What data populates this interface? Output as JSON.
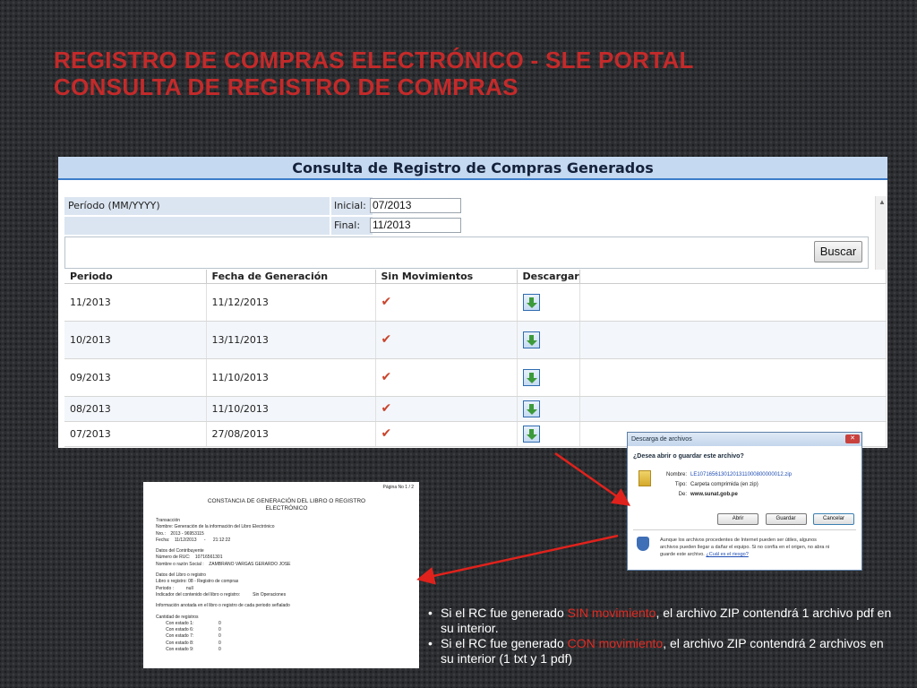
{
  "slide": {
    "title_line1": "REGISTRO DE COMPRAS ELECTRÓNICO - SLE PORTAL",
    "title_line2": "CONSULTA DE REGISTRO DE COMPRAS"
  },
  "panel": {
    "heading": "Consulta de Registro de Compras Generados",
    "period_label": "Período (MM/YYYY)",
    "initial_label": "Inicial:",
    "initial_value": "07/2013",
    "final_label": "Final:",
    "final_value": "11/2013",
    "search_button": "Buscar",
    "columns": [
      "Periodo",
      "Fecha de Generación",
      "Sin Movimientos",
      "Descargar"
    ],
    "rows": [
      {
        "periodo": "11/2013",
        "fecha": "11/12/2013",
        "sin_mov": "✔"
      },
      {
        "periodo": "10/2013",
        "fecha": "13/11/2013",
        "sin_mov": "✔"
      },
      {
        "periodo": "09/2013",
        "fecha": "11/10/2013",
        "sin_mov": "✔"
      },
      {
        "periodo": "08/2013",
        "fecha": "11/10/2013",
        "sin_mov": "✔"
      },
      {
        "periodo": "07/2013",
        "fecha": "27/08/2013",
        "sin_mov": "✔"
      }
    ]
  },
  "dialog": {
    "title": "Descarga de archivos",
    "close": "✕",
    "question": "¿Desea abrir o guardar este archivo?",
    "name_label": "Nombre:",
    "name_value": "LE10716561301201311000800000012.zip",
    "type_label": "Tipo:",
    "type_value": "Carpeta comprimida (en zip)",
    "from_label": "De:",
    "from_value": "www.sunat.gob.pe",
    "open_button": "Abrir",
    "save_button": "Guardar",
    "cancel_button": "Cancelar",
    "warning_text": "Aunque los archivos procedentes de Internet pueden ser útiles, algunos archivos pueden llegar a dañar el equipo. Si no confía en el origen, no abra ni guarde este archivo.",
    "warning_link": "¿Cuál es el riesgo?"
  },
  "pdf": {
    "page": "Página No 1 / 2",
    "title_line1": "CONSTANCIA DE GENERACIÓN DEL LIBRO O REGISTRO",
    "title_line2": "ELECTRÓNICO",
    "lines_1": [
      "Transacción",
      "Nombre: Generación de la información del Libro Electrónico",
      "Nro.:    2013 - 96953115",
      "Fecha:    11/12/2013      -      21:12:22"
    ],
    "lines_2": [
      "Datos del Contribuyente",
      "Número de RUC:    10716561301",
      "Nombre o razón Social :    ZAMBRANO VARGAS GERARDO JOSE"
    ],
    "lines_3": [
      "Datos del Libro o registro",
      "Libro o registro: 08 - Registro de compras",
      "Periodo :          null",
      "Indicador del contenido del libro o registro:          Sin Operaciones"
    ],
    "lines_4": [
      "Información anotada en el libro o registro de cada periodo señalado"
    ],
    "lines_5": [
      "Cantidad de registros",
      "        Con estado 1:                    0",
      "        Con estado 6:                    0",
      "        Con estado 7:                    0",
      "        Con estado 8:                    0",
      "        Con estado 9:                    0"
    ]
  },
  "bullets": [
    {
      "pre": "Si el RC fue generado ",
      "hl": "SIN movimiento",
      "post": ", el archivo ZIP contendrá 1 archivo pdf en su interior."
    },
    {
      "pre": "Si el RC fue generado ",
      "hl": "CON movimiento",
      "post": ", el archivo ZIP contendrá 2 archivos en su interior (1 txt y 1 pdf)"
    }
  ],
  "colors": {
    "title": "#c42a2a",
    "highlight": "#e02a22",
    "arrow": "#e0221c"
  }
}
